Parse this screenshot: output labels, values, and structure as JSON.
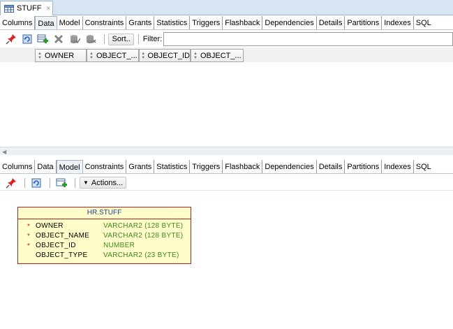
{
  "document_tab": {
    "label": "STUFF",
    "close": "×"
  },
  "top_subtabs": [
    {
      "label": "Columns",
      "active": false
    },
    {
      "label": "Data",
      "active": true
    },
    {
      "label": "Model",
      "active": false
    },
    {
      "label": "Constraints",
      "active": false
    },
    {
      "label": "Grants",
      "active": false
    },
    {
      "label": "Statistics",
      "active": false
    },
    {
      "label": "Triggers",
      "active": false
    },
    {
      "label": "Flashback",
      "active": false
    },
    {
      "label": "Dependencies",
      "active": false
    },
    {
      "label": "Details",
      "active": false
    },
    {
      "label": "Partitions",
      "active": false
    },
    {
      "label": "Indexes",
      "active": false
    },
    {
      "label": "SQL",
      "active": false
    }
  ],
  "data_toolbar": {
    "sort_label": "Sort..",
    "filter_label": "Filter:",
    "filter_value": "",
    "icons": [
      "pin-icon",
      "refresh-icon",
      "insert-row-icon",
      "delete-row-icon",
      "commit-icon",
      "rollback-icon"
    ]
  },
  "grid_columns": [
    "OWNER",
    "OBJECT_...",
    "OBJECT_ID",
    "OBJECT_..."
  ],
  "bottom_subtabs": [
    {
      "label": "Columns",
      "active": false
    },
    {
      "label": "Data",
      "active": false
    },
    {
      "label": "Model",
      "active": true
    },
    {
      "label": "Constraints",
      "active": false
    },
    {
      "label": "Grants",
      "active": false
    },
    {
      "label": "Statistics",
      "active": false
    },
    {
      "label": "Triggers",
      "active": false
    },
    {
      "label": "Flashback",
      "active": false
    },
    {
      "label": "Dependencies",
      "active": false
    },
    {
      "label": "Details",
      "active": false
    },
    {
      "label": "Partitions",
      "active": false
    },
    {
      "label": "Indexes",
      "active": false
    },
    {
      "label": "SQL",
      "active": false
    }
  ],
  "model_toolbar": {
    "actions_label": "Actions...",
    "icons": [
      "pin-icon",
      "refresh-icon",
      "layout-icon"
    ]
  },
  "entity": {
    "title": "HR.STUFF",
    "columns": [
      {
        "required": true,
        "star": "*",
        "name": "OWNER",
        "type": "VARCHAR2 (128 BYTE)"
      },
      {
        "required": true,
        "star": "*",
        "name": "OBJECT_NAME",
        "type": "VARCHAR2 (128 BYTE)"
      },
      {
        "required": true,
        "star": "*",
        "name": "OBJECT_ID",
        "type": "NUMBER"
      },
      {
        "required": false,
        "star": "",
        "name": "OBJECT_TYPE",
        "type": "VARCHAR2 (23 BYTE)"
      }
    ]
  },
  "colors": {
    "entity_border": "#c01f1f",
    "entity_fill": "#fffdc9",
    "entity_title": "#1f3d8f",
    "type_text": "#3c8a1f"
  }
}
